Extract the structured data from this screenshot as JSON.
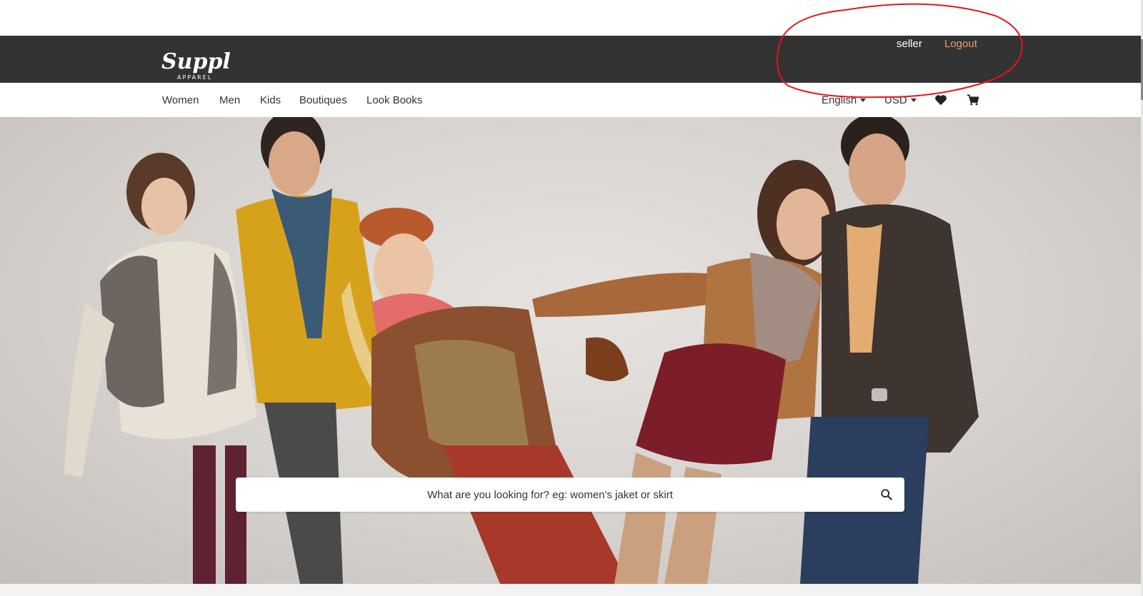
{
  "header": {
    "logo_text": "Supply",
    "logo_subtext": "APPAREL",
    "user": {
      "username": "seller",
      "logout_label": "Logout"
    }
  },
  "nav": {
    "items": [
      {
        "label": "Women"
      },
      {
        "label": "Men"
      },
      {
        "label": "Kids"
      },
      {
        "label": "Boutiques"
      },
      {
        "label": "Look Books"
      }
    ],
    "language": "English",
    "currency": "USD",
    "wishlist_icon": "heart-icon",
    "cart_icon": "cart-icon"
  },
  "search": {
    "placeholder": "What are you looking for? eg: women's jaket or skirt",
    "icon": "search-icon"
  },
  "annotation": {
    "color": "#e3161b"
  },
  "colors": {
    "header_bg": "#333333",
    "logout_accent": "#e0a46a"
  }
}
